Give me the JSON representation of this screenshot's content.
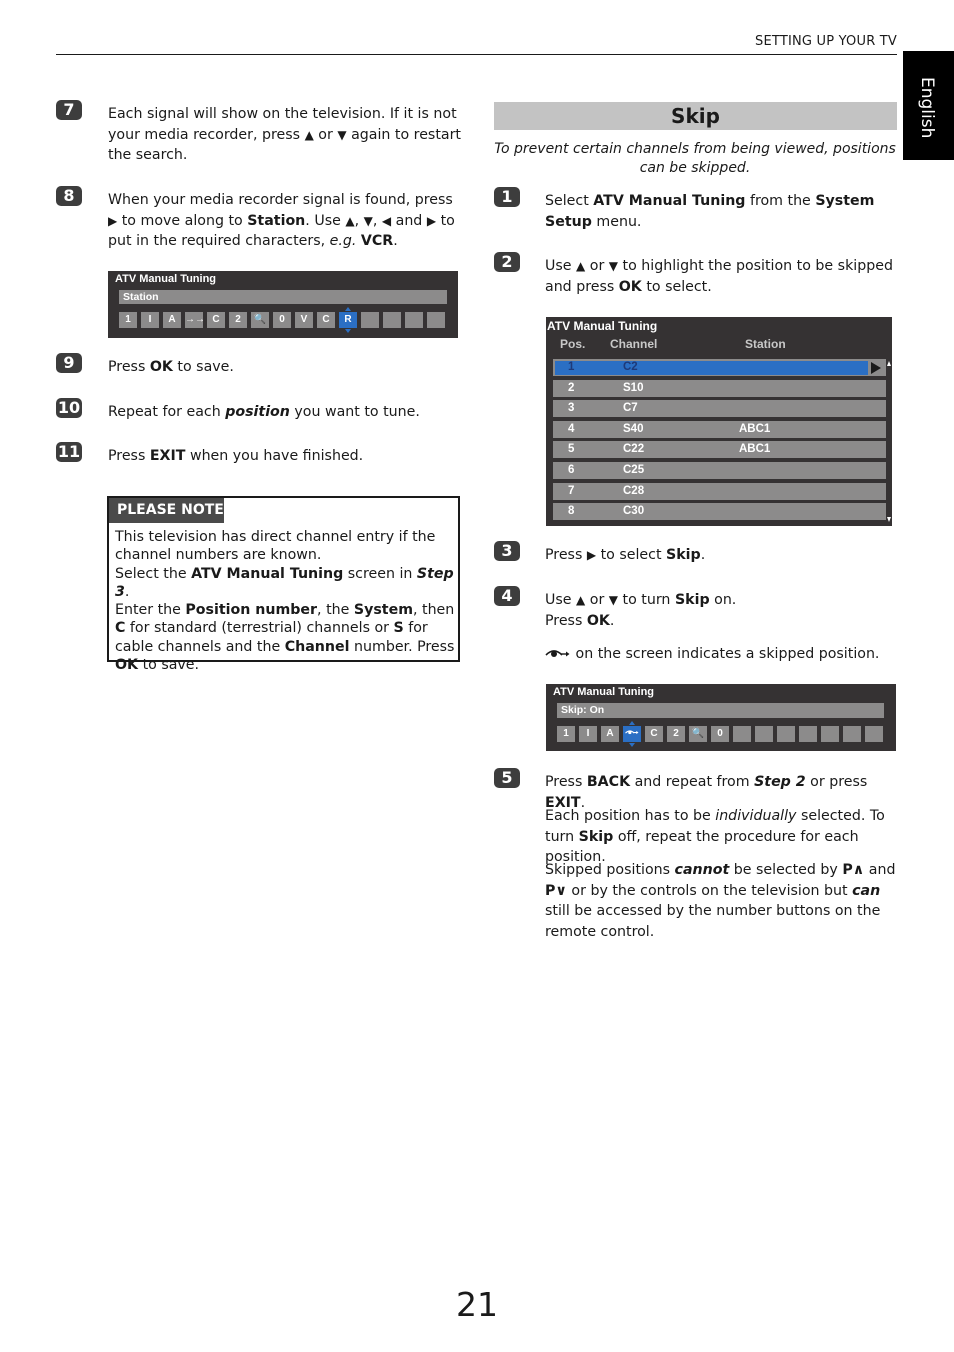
{
  "header": {
    "section_title": "SETTING UP YOUR TV",
    "language_tab": "English"
  },
  "left_steps": [
    {
      "num": "7",
      "parts": [
        "Each signal will show on the television. If it is not your media recorder, press ",
        "▲",
        " or ",
        "▼",
        " again to restart the search."
      ]
    },
    {
      "num": "8",
      "parts": [
        "When your media recorder signal is found, press ",
        "▶",
        " to move along to ",
        "Station",
        ". Use ",
        "▲",
        ", ",
        "▼",
        ", ",
        "◀",
        " and ",
        "▶",
        " to put in the required characters, ",
        "e.g.",
        " ",
        "VCR",
        "."
      ]
    },
    {
      "num": "9",
      "parts": [
        "Press ",
        "OK",
        " to save."
      ]
    },
    {
      "num": "10",
      "parts": [
        "Repeat for each ",
        "position",
        " you want to tune."
      ]
    },
    {
      "num": "11",
      "parts": [
        "Press ",
        "EXIT",
        " when you have finished."
      ]
    }
  ],
  "screen_station": {
    "title": "ATV Manual Tuning",
    "field_label": "Station",
    "cells": [
      "1",
      "I",
      "A",
      "→→",
      "C",
      "2",
      "🔍",
      "0",
      "V",
      "C",
      "R",
      "",
      "",
      "",
      ""
    ],
    "selected_index": 10
  },
  "please_note": {
    "heading": "PLEASE NOTE",
    "parts": [
      "This television has direct channel entry if the channel numbers are known.",
      "Select the ",
      "ATV Manual Tuning",
      " screen in ",
      "Step 3",
      ".",
      "Enter the ",
      "Position number",
      ", the ",
      "System",
      ", then ",
      "C",
      " for standard (terrestrial) channels or ",
      "S",
      " for cable channels and the ",
      "Channel",
      " number. Press ",
      "OK",
      " to save."
    ]
  },
  "skip_section": {
    "heading": "Skip",
    "intro": "To prevent certain channels from being viewed, positions can be skipped."
  },
  "right_steps": [
    {
      "num": "1",
      "parts": [
        "Select ",
        "ATV Manual Tuning",
        " from the ",
        "System Setup",
        " menu."
      ]
    },
    {
      "num": "2",
      "parts": [
        "Use ",
        "▲",
        " or ",
        "▼",
        " to highlight the position to be skipped and press ",
        "OK",
        " to select."
      ]
    },
    {
      "num": "3",
      "parts": [
        "Press ",
        "▶",
        " to select ",
        "Skip",
        "."
      ]
    },
    {
      "num": "4",
      "parts": [
        "Use ",
        "▲",
        " or ",
        "▼",
        " to turn ",
        "Skip",
        " on.",
        "Press ",
        "OK",
        ".",
        " on the screen indicates a skipped position."
      ]
    },
    {
      "num": "5",
      "parts": [
        "Press ",
        "BACK",
        " and repeat from ",
        "Step 2",
        " or press ",
        "EXIT",
        ".",
        "Each position has to be ",
        "individually",
        " selected. To turn ",
        "Skip",
        " off, repeat the procedure for each position.",
        "Skipped positions ",
        "cannot",
        " be selected by ",
        "P∧",
        " and ",
        "P∨",
        " or by the controls on the television but ",
        "can",
        " still be accessed by the number buttons on the remote control."
      ]
    }
  ],
  "screen_list": {
    "title": "ATV Manual Tuning",
    "columns": [
      "Pos.",
      "Channel",
      "Station"
    ],
    "rows": [
      {
        "pos": "1",
        "channel": "C2",
        "station": ""
      },
      {
        "pos": "2",
        "channel": "S10",
        "station": ""
      },
      {
        "pos": "3",
        "channel": "C7",
        "station": ""
      },
      {
        "pos": "4",
        "channel": "S40",
        "station": "ABC1"
      },
      {
        "pos": "5",
        "channel": "C22",
        "station": "ABC1"
      },
      {
        "pos": "6",
        "channel": "C25",
        "station": ""
      },
      {
        "pos": "7",
        "channel": "C28",
        "station": ""
      },
      {
        "pos": "8",
        "channel": "C30",
        "station": ""
      }
    ],
    "selected_row": 0
  },
  "screen_skip": {
    "title": "ATV Manual Tuning",
    "field_label": "Skip: On",
    "cells": [
      "1",
      "I",
      "A",
      "skip",
      "C",
      "2",
      "🔍",
      "0",
      "",
      "",
      "",
      "",
      "",
      "",
      ""
    ],
    "selected_index": 3
  },
  "page_number": "21",
  "colors": {
    "selection_blue": "#2b6fc4",
    "screen_bg": "#353233",
    "field_grey": "#8c8b8b"
  }
}
